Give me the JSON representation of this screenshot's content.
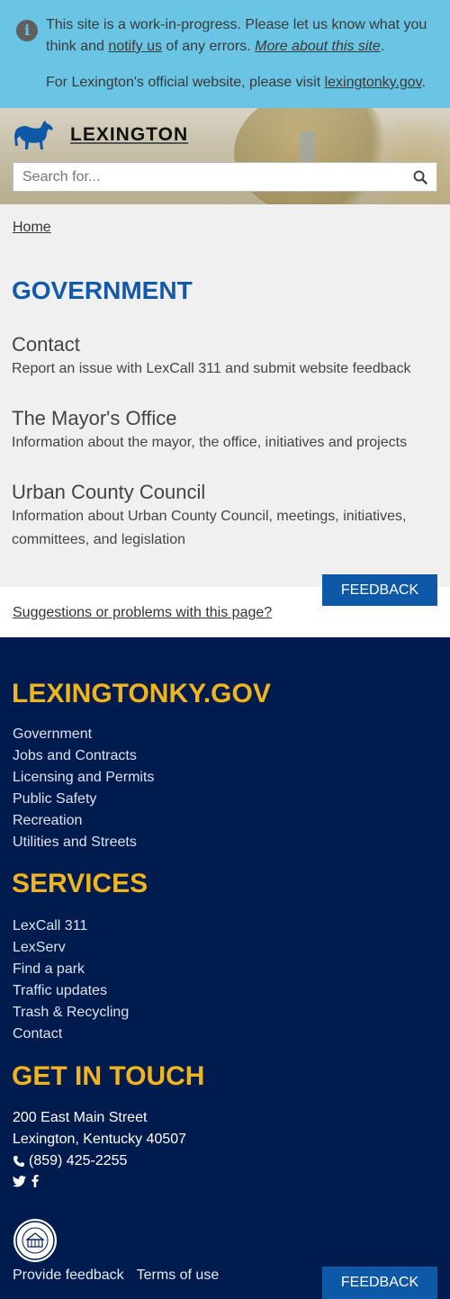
{
  "alert": {
    "line1_a": "This site is a work-in-progress. Please let us know what you think and ",
    "notify_link": "notify us",
    "line1_b": " of any errors. ",
    "more_link": "More about this site",
    "line1_c": ".",
    "line2_a": "For Lexington's official website, please visit ",
    "official_link": "lexingtonky.gov",
    "line2_b": "."
  },
  "header": {
    "brand": "LEXINGTON",
    "search_placeholder": "Search for..."
  },
  "breadcrumb": {
    "home": "Home"
  },
  "main": {
    "title": "GOVERNMENT",
    "items": [
      {
        "title": "Contact",
        "desc": "Report an issue with LexCall 311 and submit website feedback"
      },
      {
        "title": "The Mayor's Office",
        "desc": "Information about the mayor, the office, initiatives and projects"
      },
      {
        "title": "Urban County Council",
        "desc": "Information about Urban County Council, meetings, initiatives, committees, and legislation"
      }
    ]
  },
  "feedback": {
    "button": "FEEDBACK",
    "suggest": "Suggestions or problems with this page?"
  },
  "footer": {
    "site_title": "LEXINGTONKY.GOV",
    "site_links": [
      "Government",
      "Jobs and Contracts",
      "Licensing and Permits",
      "Public Safety",
      "Recreation",
      "Utilities and Streets"
    ],
    "services_title": "SERVICES",
    "services_links": [
      "LexCall 311",
      "LexServ",
      "Find a park",
      "Traffic updates",
      "Trash & Recycling",
      "Contact"
    ],
    "touch_title": "GET IN TOUCH",
    "address1": "200 East Main Street",
    "address2": "Lexington, Kentucky 40507",
    "phone": "(859) 425-2255",
    "provide_feedback": "Provide feedback",
    "terms": "Terms of use",
    "feedback_button": "FEEDBACK"
  },
  "colors": {
    "alert_bg": "#6ac4e4",
    "brand_blue": "#1359ab",
    "footer_bg": "#001c4e",
    "footer_heading": "#f0b51c",
    "button_bg": "#0e58a8"
  }
}
